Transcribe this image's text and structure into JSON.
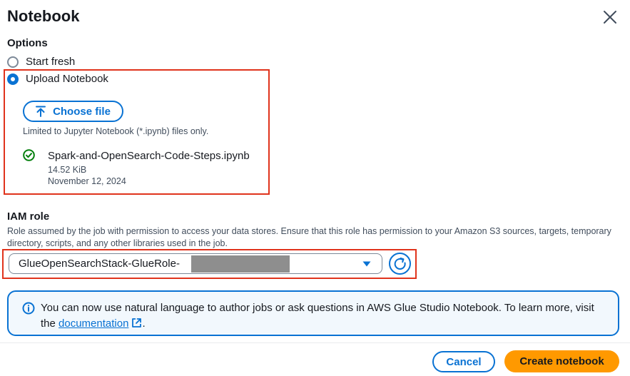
{
  "modal": {
    "title": "Notebook"
  },
  "options": {
    "label": "Options",
    "start_fresh": "Start fresh",
    "upload": "Upload Notebook",
    "selected": "Upload Notebook"
  },
  "upload": {
    "button_label": "Choose file",
    "constraint": "Limited to Jupyter Notebook (*.ipynb) files only.",
    "file": {
      "name": "Spark-and-OpenSearch-Code-Steps.ipynb",
      "size": "14.52 KiB",
      "date": "November 12, 2024"
    }
  },
  "iam_role": {
    "label": "IAM role",
    "description": "Role assumed by the job with permission to access your data stores. Ensure that this role has permission to your Amazon S3 sources, targets, temporary directory, scripts, and any other libraries used in the job.",
    "selected_value": "GlueOpenSearchStack-GlueRole-"
  },
  "info": {
    "text_before": "You can now use natural language to author jobs or ask questions in AWS Glue Studio Notebook. To learn more, visit the ",
    "link_text": "documentation",
    "text_after": "."
  },
  "footer": {
    "cancel_label": "Cancel",
    "create_label": "Create notebook"
  },
  "colors": {
    "accent": "#0972d3",
    "primary_button": "#ff9900",
    "highlight": "#e0331c",
    "success": "#037f0c",
    "info_background": "#f2f8fd"
  },
  "icons": [
    "close-icon",
    "upload-icon",
    "success-check-icon",
    "caret-down-icon",
    "refresh-icon",
    "info-icon",
    "external-link-icon"
  ]
}
